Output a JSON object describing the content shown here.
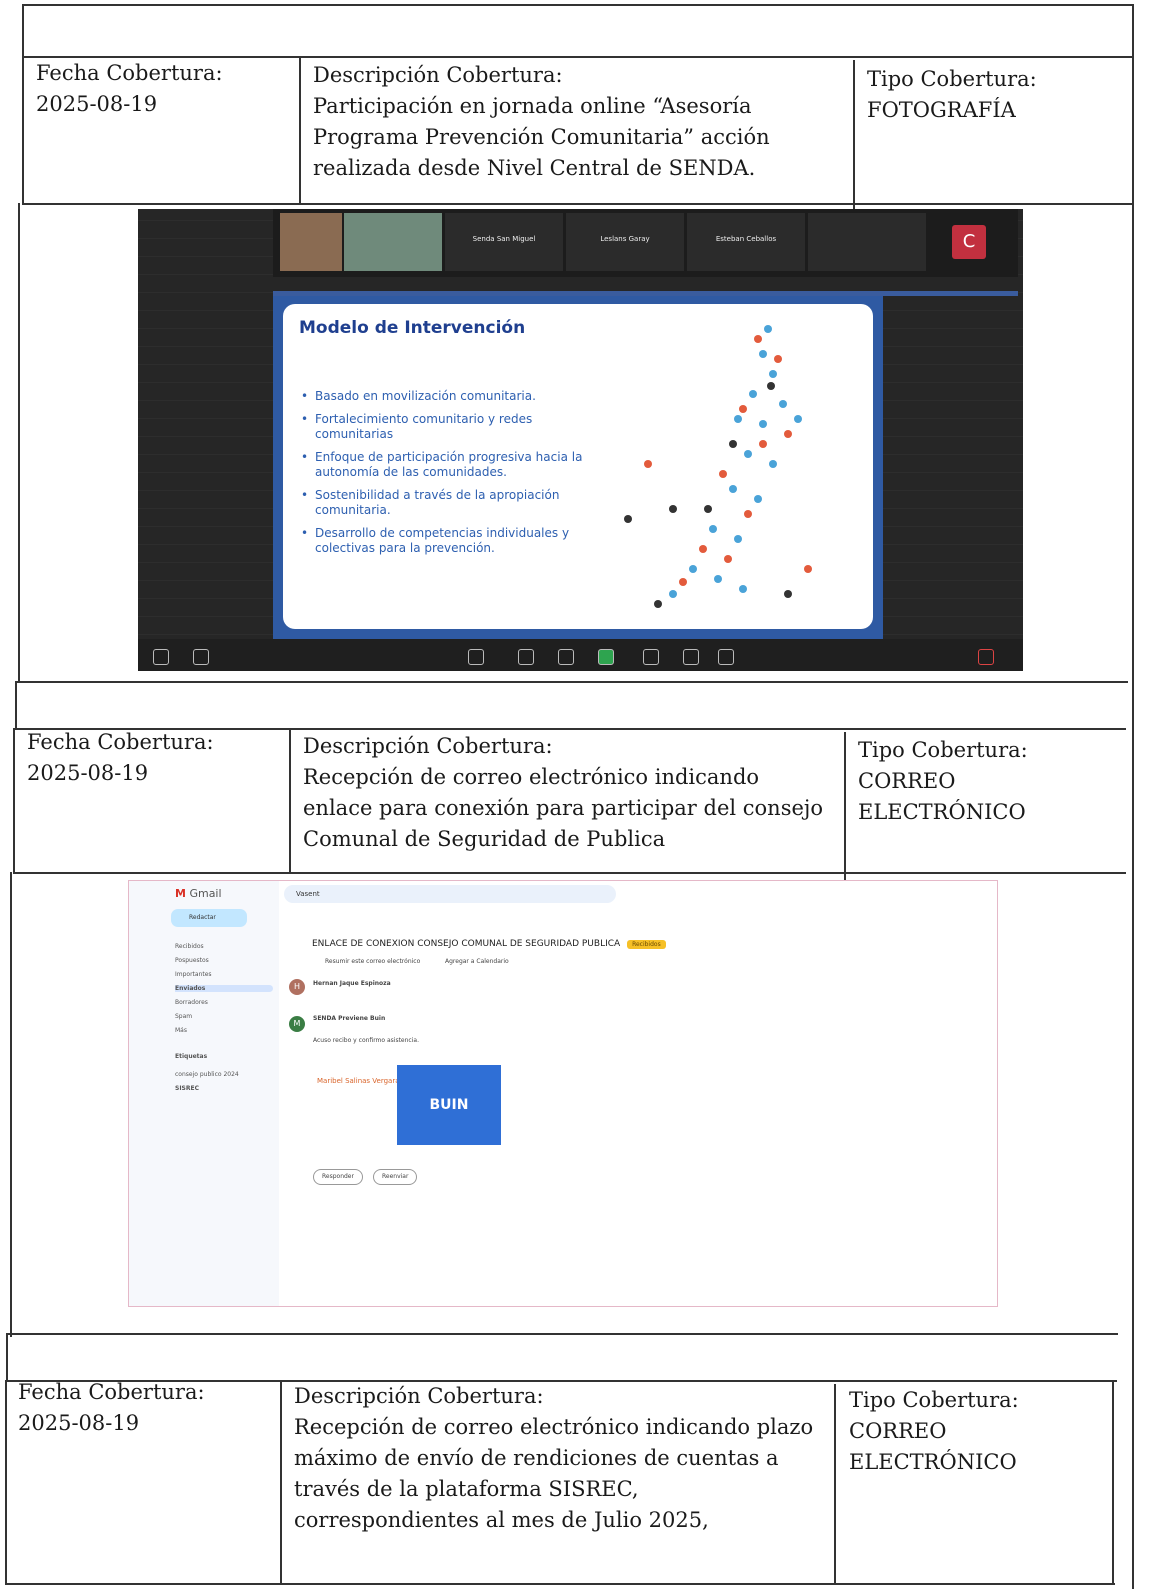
{
  "labels": {
    "fecha": "Fecha Cobertura:",
    "descripcion": "Descripción Cobertura:",
    "tipo": "Tipo Cobertura:"
  },
  "rows": [
    {
      "fecha": "2025-08-19",
      "descripcion": [
        "Participación en jornada online “Asesoría",
        "Programa Prevención Comunitaria” acción",
        "realizada desde Nivel Central de SENDA."
      ],
      "tipo": [
        "FOTOGRAFÍA"
      ]
    },
    {
      "fecha": "2025-08-19",
      "descripcion": [
        "Recepción de correo electrónico indicando",
        "enlace para conexión para participar del consejo",
        "Comunal de Seguridad de Publica"
      ],
      "tipo": [
        "CORREO",
        "ELECTRÓNICO"
      ]
    },
    {
      "fecha": "2025-08-19",
      "descripcion": [
        "Recepción de correo electrónico indicando plazo",
        "máximo de envío de rendiciones de cuentas a",
        "través de la plataforma SISREC,",
        "correspondientes al mes de Julio 2025,"
      ],
      "tipo": [
        "CORREO",
        "ELECTRÓNICO"
      ]
    }
  ],
  "zoom": {
    "participants": [
      "Senda San Miguel",
      "Leslans Garay",
      "Esteban Ceballos"
    ],
    "avatar_letter": "C",
    "slide_title": "Modelo de Intervención",
    "bullets": [
      "Basado en movilización comunitaria.",
      "Fortalecimiento comunitario y redes comunitarias",
      "Enfoque de participación progresiva hacia la autonomía de las comunidades.",
      "Sostenibilidad a través de la apropiación comunitaria.",
      "Desarrollo de competencias individuales y colectivas para la prevención."
    ]
  },
  "gmail": {
    "app": "Gmail",
    "compose": "Redactar",
    "search": "Vasent",
    "nav": [
      "Recibidos",
      "Pospuestos",
      "Importantes",
      "Enviados",
      "Borradores",
      "Spam",
      "Más"
    ],
    "labels_title": "Etiquetas",
    "labels": [
      "consejo publico 2024",
      "SISREC"
    ],
    "subject": "ENLACE DE CONEXION CONSEJO COMUNAL DE SEGURIDAD PUBLICA",
    "subject_tag": "Recibidos",
    "actions": [
      "Resumir este correo electrónico",
      "Agregar a Calendario"
    ],
    "sender1": "Hernan Jaque Espinoza",
    "sender2": "SENDA Previene Buin",
    "body2": "Acuso recibo y confirmo asistencia.",
    "signature_name": "Maribel Salinas Vergara",
    "logo_text": "BUIN",
    "reply": "Responder",
    "forward": "Reenviar"
  }
}
